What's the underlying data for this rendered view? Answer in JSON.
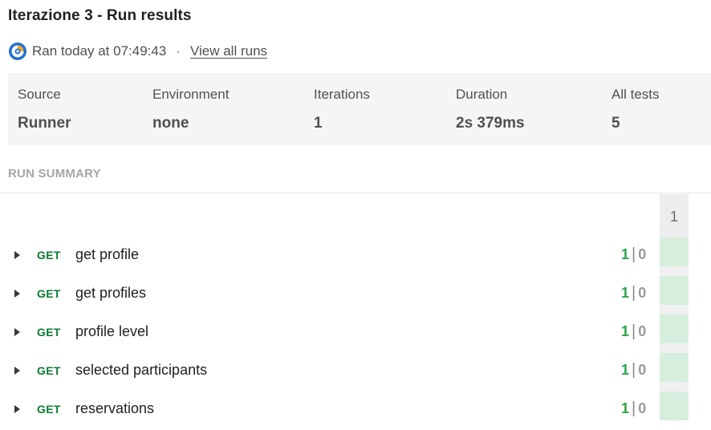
{
  "header": {
    "title": "Iterazione 3 - Run results",
    "ran_text": "Ran today at 07:49:43",
    "separator": "·",
    "view_all_runs": "View all runs",
    "icon": "postman-runner-icon"
  },
  "stats": {
    "source": {
      "label": "Source",
      "value": "Runner"
    },
    "environment": {
      "label": "Environment",
      "value": "none"
    },
    "iterations": {
      "label": "Iterations",
      "value": "1"
    },
    "duration": {
      "label": "Duration",
      "value": "2s 379ms"
    },
    "all_tests": {
      "label": "All tests",
      "value": "5"
    }
  },
  "summary": {
    "heading": "RUN SUMMARY",
    "iteration_header": "1",
    "requests": [
      {
        "method": "GET",
        "name": "get profile",
        "passed": "1",
        "sep": "|",
        "failed": "0"
      },
      {
        "method": "GET",
        "name": "get profiles",
        "passed": "1",
        "sep": "|",
        "failed": "0"
      },
      {
        "method": "GET",
        "name": "profile level",
        "passed": "1",
        "sep": "|",
        "failed": "0"
      },
      {
        "method": "GET",
        "name": "selected participants",
        "passed": "1",
        "sep": "|",
        "failed": "0"
      },
      {
        "method": "GET",
        "name": "reservations",
        "passed": "1",
        "sep": "|",
        "failed": "0"
      }
    ]
  },
  "colors": {
    "method_get": "#0a7c33",
    "pass": "#2ca44a",
    "fail": "#9a9a9a",
    "pass_cell": "#d6eedd"
  }
}
